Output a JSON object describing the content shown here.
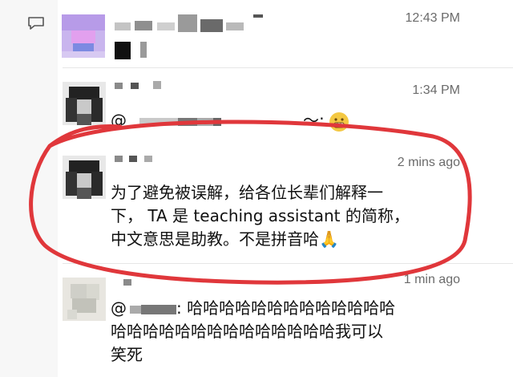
{
  "messages": [
    {
      "time": "12:43 PM",
      "line1": "",
      "line2": ""
    },
    {
      "time": "1:34 PM",
      "mention_prefix": "@",
      "mention_suffix": "～: "
    },
    {
      "time": "2 mins ago",
      "line1": "为了避免被误解，给各位长辈们解释一",
      "line2": "下， TA 是 teaching assistant 的简称，",
      "line3": "中文意思是助教。不是拼音哈🙏"
    },
    {
      "time": "1 min ago",
      "line1_prefix": "@",
      "line1_suffix": ": 哈哈哈哈哈哈哈哈哈哈哈哈哈",
      "line2": "哈哈哈哈哈哈哈哈哈哈哈哈哈哈我可以",
      "line3": "笑死"
    }
  ],
  "colors": {
    "annotation_red": "#e0373b",
    "timestamp_gray": "#6b6b6b"
  }
}
